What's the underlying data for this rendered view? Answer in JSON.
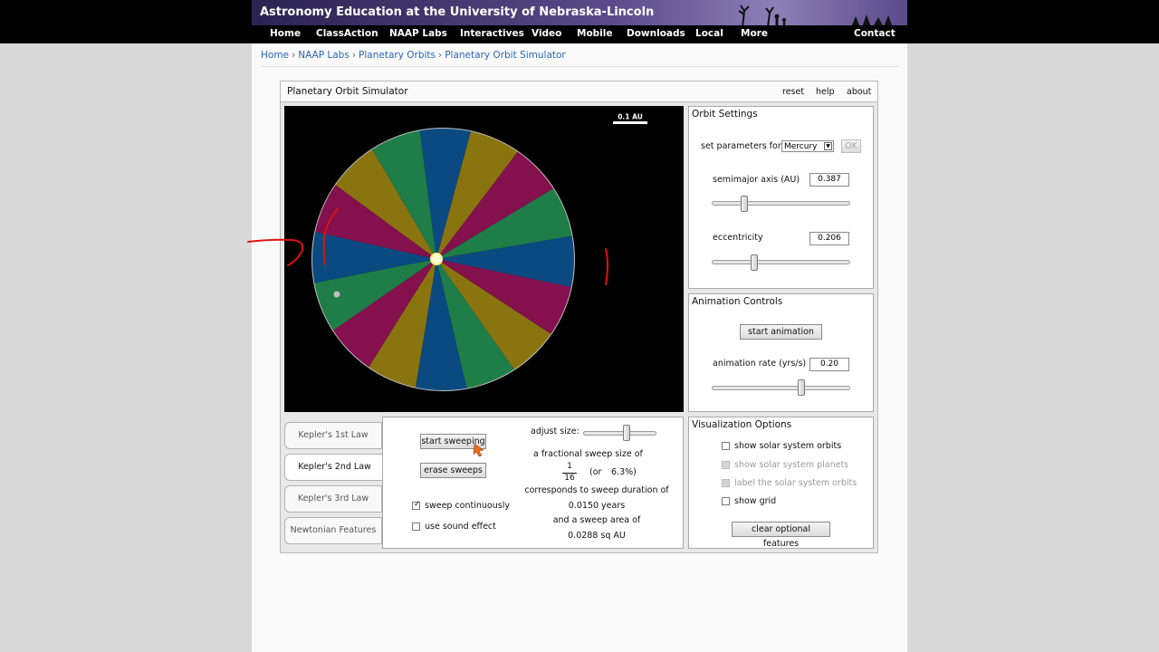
{
  "site": {
    "title": "Astronomy Education at the University of Nebraska-Lincoln",
    "nav": [
      "Home",
      "ClassAction",
      "NAAP Labs",
      "Interactives",
      "Video",
      "Mobile",
      "Downloads",
      "Local",
      "More"
    ],
    "nav_contact": "Contact"
  },
  "breadcrumb": [
    "Home",
    "NAAP Labs",
    "Planetary Orbits",
    "Planetary Orbit Simulator"
  ],
  "breadcrumb_sep": "›",
  "app": {
    "title": "Planetary Orbit Simulator",
    "links": [
      "reset",
      "help",
      "about"
    ]
  },
  "orbit_view": {
    "scale_label": "0.1 AU",
    "sweep_colors": [
      "#0b4a80",
      "#1f7d48",
      "#84104e",
      "#8a7410"
    ]
  },
  "orbit_settings": {
    "title": "Orbit Settings",
    "set_params_label": "set parameters for:",
    "planet_selected": "Mercury",
    "ok_label": "OK",
    "semimajor_label": "semimajor axis (AU)",
    "semimajor_value": "0.387",
    "eccentricity_label": "eccentricity",
    "eccentricity_value": "0.206"
  },
  "animation_controls": {
    "title": "Animation Controls",
    "start_label": "start animation",
    "rate_label": "animation rate (yrs/s)",
    "rate_value": "0.20"
  },
  "law_tabs": [
    "Kepler's 1st Law",
    "Kepler's 2nd Law",
    "Kepler's 3rd Law",
    "Newtonian Features"
  ],
  "sweep": {
    "start_label": "start sweeping",
    "erase_label": "erase sweeps",
    "continuous_label": "sweep continuously",
    "continuous_checked": true,
    "sound_label": "use sound effect",
    "sound_checked": false,
    "adjust_label": "adjust size:",
    "fraction_intro": "a fractional sweep size of",
    "fraction_num": "1",
    "fraction_den": "16",
    "fraction_or": "(or",
    "fraction_pct": "6.3%)",
    "duration_intro": "corresponds to sweep duration of",
    "duration_value": "0.0150 years",
    "area_intro": "and a sweep area of",
    "area_value": "0.0288 sq AU"
  },
  "visualization": {
    "title": "Visualization Options",
    "options": [
      {
        "label": "show solar system orbits",
        "checked": false,
        "enabled": true
      },
      {
        "label": "show solar system planets",
        "checked": false,
        "enabled": false
      },
      {
        "label": "label the solar system orbits",
        "checked": false,
        "enabled": false
      },
      {
        "label": "show grid",
        "checked": false,
        "enabled": true
      }
    ],
    "clear_label": "clear optional features"
  }
}
